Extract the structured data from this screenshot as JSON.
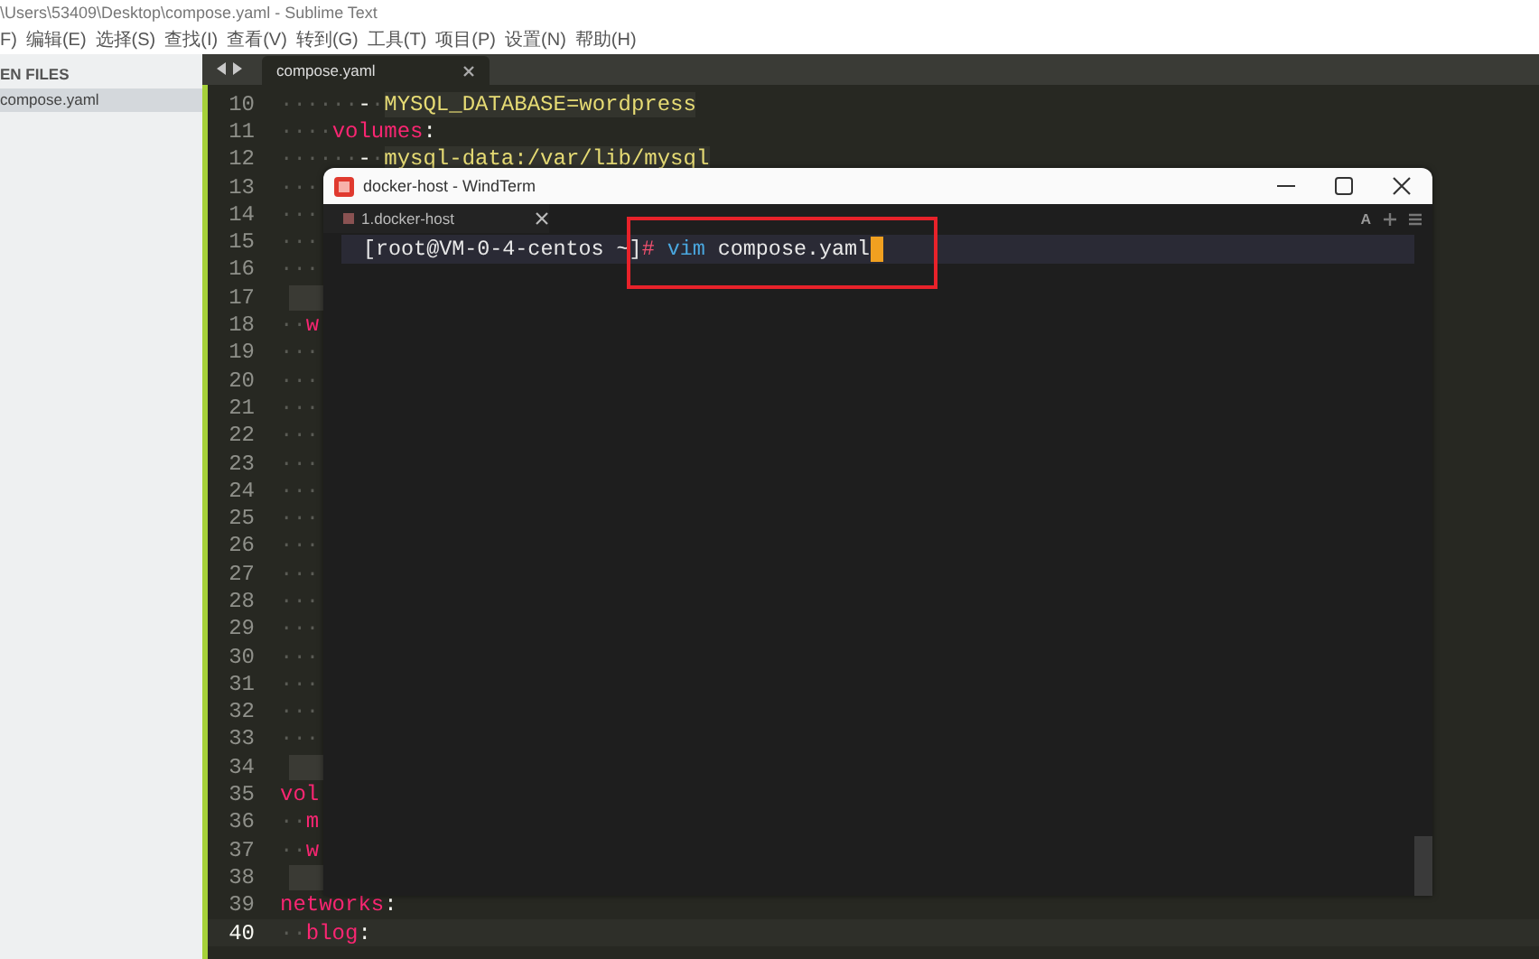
{
  "window": {
    "title": "\\Users\\53409\\Desktop\\compose.yaml - Sublime Text"
  },
  "menu": [
    "F)",
    "编辑(E)",
    "选择(S)",
    "查找(I)",
    "查看(V)",
    "转到(G)",
    "工具(T)",
    "项目(P)",
    "设置(N)",
    "帮助(H)"
  ],
  "sidebar": {
    "header": "EN FILES",
    "files": [
      {
        "name": "compose.yaml",
        "selected": true
      }
    ]
  },
  "editor": {
    "tabs": [
      {
        "label": "compose.yaml",
        "selected": true
      }
    ],
    "lines": [
      {
        "number": "10",
        "current": false,
        "parts": [
          {
            "text": "······",
            "kind": "ws"
          },
          {
            "text": "-",
            "kind": "plain"
          },
          {
            "text": "·",
            "kind": "ws"
          },
          {
            "text": "MYSQL_DATABASE=wordpress",
            "kind": "string"
          }
        ]
      },
      {
        "number": "11",
        "current": false,
        "parts": [
          {
            "text": "····",
            "kind": "ws"
          },
          {
            "text": "volumes",
            "kind": "key"
          },
          {
            "text": ":",
            "kind": "plain"
          }
        ]
      },
      {
        "number": "12",
        "current": false,
        "parts": [
          {
            "text": "······",
            "kind": "ws"
          },
          {
            "text": "-",
            "kind": "plain"
          },
          {
            "text": "·",
            "kind": "ws"
          },
          {
            "text": "mysql-data:/var/lib/mysql",
            "kind": "string"
          }
        ]
      },
      {
        "number": "13",
        "current": false,
        "parts": [
          {
            "text": "···",
            "kind": "ws"
          }
        ]
      },
      {
        "number": "14",
        "current": false,
        "parts": [
          {
            "text": "···",
            "kind": "ws"
          }
        ]
      },
      {
        "number": "15",
        "current": false,
        "parts": [
          {
            "text": "···",
            "kind": "ws"
          }
        ]
      },
      {
        "number": "16",
        "current": false,
        "parts": [
          {
            "text": "···",
            "kind": "ws"
          }
        ]
      },
      {
        "number": "17",
        "current": false,
        "parts": [
          {
            "kind": "block"
          }
        ]
      },
      {
        "number": "18",
        "current": false,
        "parts": [
          {
            "text": "··",
            "kind": "ws"
          },
          {
            "text": "w",
            "kind": "key"
          }
        ]
      },
      {
        "number": "19",
        "current": false,
        "parts": [
          {
            "text": "···",
            "kind": "ws"
          }
        ]
      },
      {
        "number": "20",
        "current": false,
        "parts": [
          {
            "text": "···",
            "kind": "ws"
          }
        ]
      },
      {
        "number": "21",
        "current": false,
        "parts": [
          {
            "text": "···",
            "kind": "ws"
          }
        ]
      },
      {
        "number": "22",
        "current": false,
        "parts": [
          {
            "text": "···",
            "kind": "ws"
          }
        ]
      },
      {
        "number": "23",
        "current": false,
        "parts": [
          {
            "text": "···",
            "kind": "ws"
          }
        ]
      },
      {
        "number": "24",
        "current": false,
        "parts": [
          {
            "text": "···",
            "kind": "ws"
          }
        ]
      },
      {
        "number": "25",
        "current": false,
        "parts": [
          {
            "text": "···",
            "kind": "ws"
          }
        ]
      },
      {
        "number": "26",
        "current": false,
        "parts": [
          {
            "text": "···",
            "kind": "ws"
          }
        ]
      },
      {
        "number": "27",
        "current": false,
        "parts": [
          {
            "text": "···",
            "kind": "ws"
          }
        ]
      },
      {
        "number": "28",
        "current": false,
        "parts": [
          {
            "text": "···",
            "kind": "ws"
          }
        ]
      },
      {
        "number": "29",
        "current": false,
        "parts": [
          {
            "text": "···",
            "kind": "ws"
          }
        ]
      },
      {
        "number": "30",
        "current": false,
        "parts": [
          {
            "text": "···",
            "kind": "ws"
          }
        ]
      },
      {
        "number": "31",
        "current": false,
        "parts": [
          {
            "text": "···",
            "kind": "ws"
          }
        ]
      },
      {
        "number": "32",
        "current": false,
        "parts": [
          {
            "text": "···",
            "kind": "ws"
          }
        ]
      },
      {
        "number": "33",
        "current": false,
        "parts": [
          {
            "text": "···",
            "kind": "ws"
          }
        ]
      },
      {
        "number": "34",
        "current": false,
        "parts": [
          {
            "kind": "block"
          }
        ]
      },
      {
        "number": "35",
        "current": false,
        "parts": [
          {
            "text": "vol",
            "kind": "key"
          }
        ]
      },
      {
        "number": "36",
        "current": false,
        "parts": [
          {
            "text": "··",
            "kind": "ws"
          },
          {
            "text": "m",
            "kind": "key"
          }
        ]
      },
      {
        "number": "37",
        "current": false,
        "parts": [
          {
            "text": "··",
            "kind": "ws"
          },
          {
            "text": "w",
            "kind": "key"
          }
        ]
      },
      {
        "number": "38",
        "current": false,
        "parts": [
          {
            "kind": "block"
          }
        ]
      },
      {
        "number": "39",
        "current": false,
        "parts": [
          {
            "text": "networks",
            "kind": "key"
          },
          {
            "text": ":",
            "kind": "plain"
          }
        ]
      },
      {
        "number": "40",
        "current": true,
        "parts": [
          {
            "text": "··",
            "kind": "ws"
          },
          {
            "text": "blog",
            "kind": "key"
          },
          {
            "text": ":",
            "kind": "plain"
          }
        ]
      }
    ]
  },
  "terminal": {
    "title": "docker-host - WindTerm",
    "tabs": [
      {
        "label": "1.docker-host",
        "selected": true
      }
    ],
    "toolbar_label": "A",
    "prompt": [
      {
        "text": "[root@VM-0-4-centos ~]",
        "kind": "plain"
      },
      {
        "text": "#",
        "kind": "hash"
      },
      {
        "text": "vim",
        "kind": "command"
      },
      {
        "text": "compose.yaml",
        "kind": "plain"
      }
    ]
  }
}
